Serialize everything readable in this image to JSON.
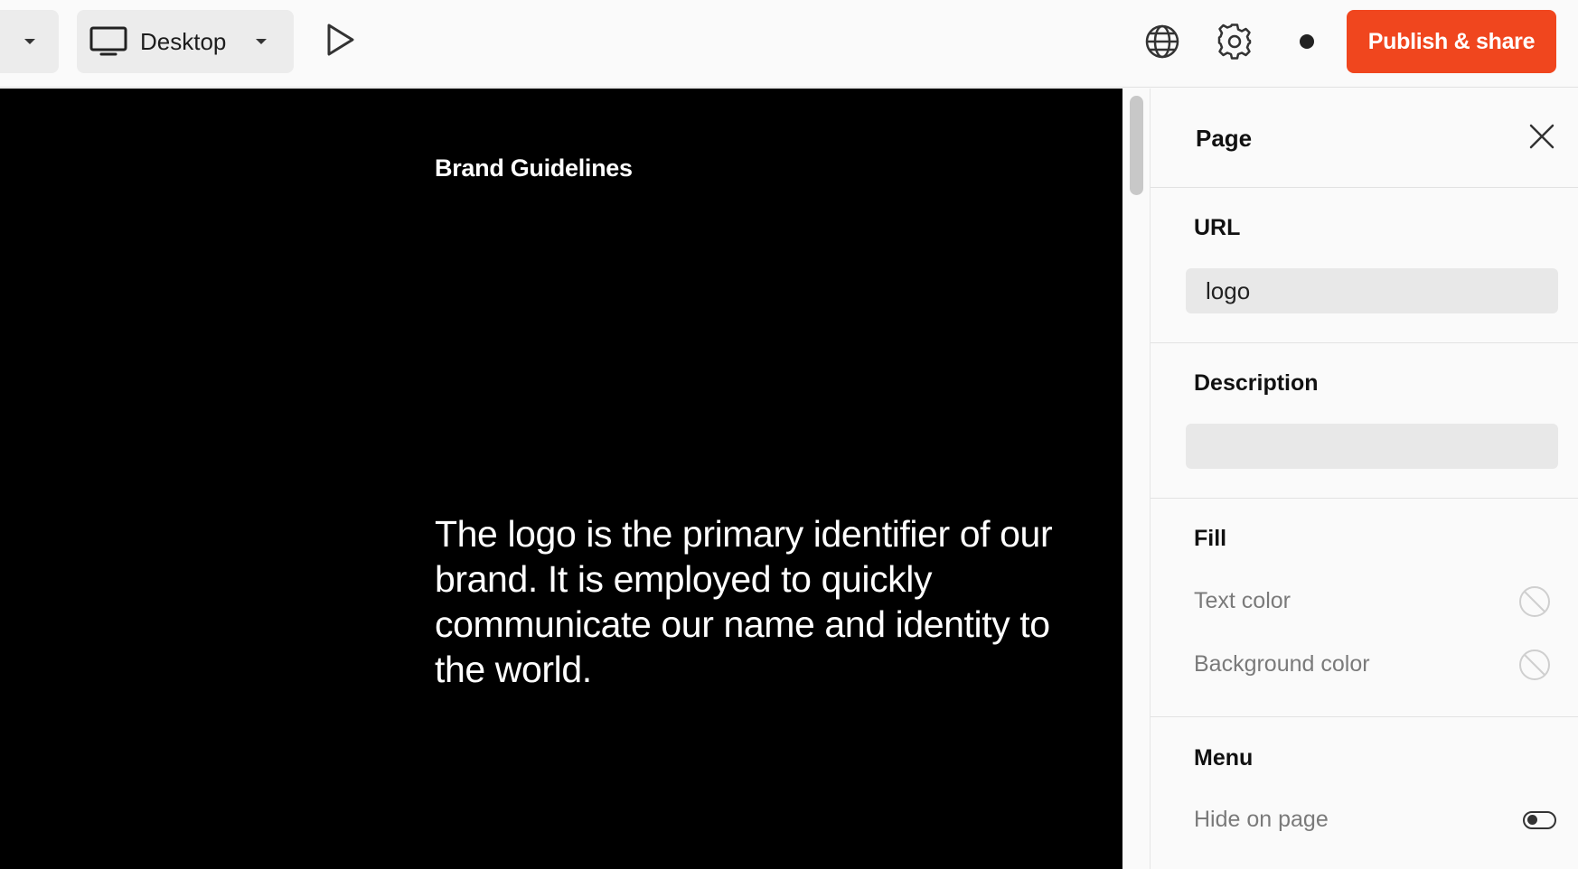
{
  "toolbar": {
    "device_label": "Desktop",
    "publish_label": "Publish & share"
  },
  "canvas": {
    "site_title": "Brand Guidelines",
    "body_text": "The logo is the primary identifier of our brand. It is employed to quickly communicate our name and identity to the world."
  },
  "panel": {
    "title": "Page",
    "url": {
      "label": "URL",
      "value": "logo"
    },
    "description": {
      "label": "Description",
      "value": ""
    },
    "fill": {
      "label": "Fill",
      "text_color": "Text color",
      "background_color": "Background color"
    },
    "menu": {
      "label": "Menu",
      "hide_on_page": "Hide on page"
    }
  },
  "colors": {
    "accent": "#f0461e",
    "canvas_bg": "#000000",
    "panel_bg": "#fafafa"
  },
  "icons": [
    "chevron-down-icon",
    "monitor-icon",
    "play-icon",
    "globe-icon",
    "gear-icon",
    "close-icon",
    "no-color-icon"
  ]
}
